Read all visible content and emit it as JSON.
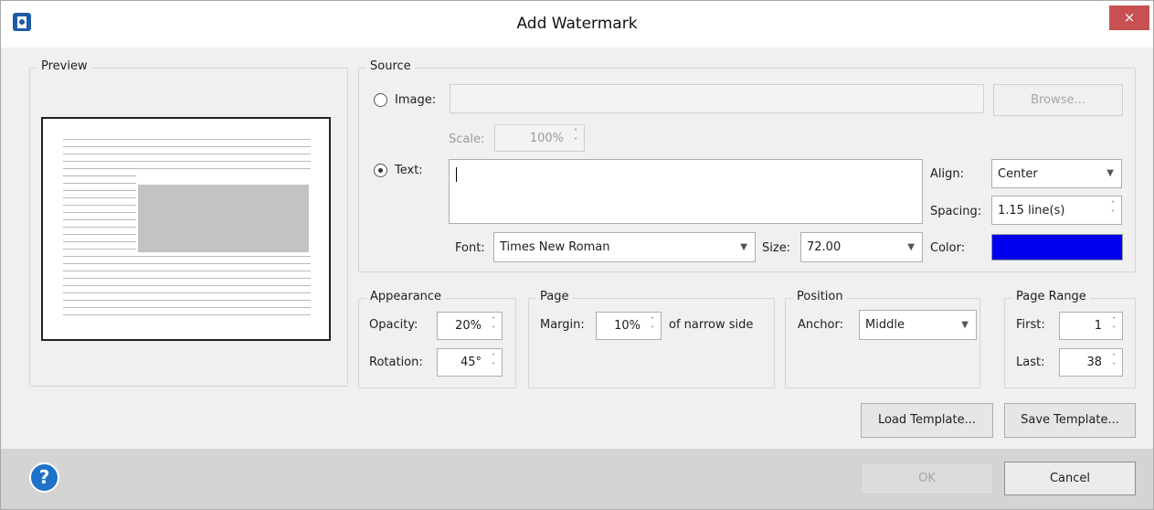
{
  "window": {
    "title": "Add Watermark",
    "close_glyph": "×"
  },
  "preview": {
    "legend": "Preview"
  },
  "source": {
    "legend": "Source",
    "image_label": "Image:",
    "image_path": "",
    "browse_label": "Browse...",
    "scale_label": "Scale:",
    "scale_value": "100%",
    "text_label": "Text:",
    "text_value": "",
    "align_label": "Align:",
    "align_value": "Center",
    "spacing_label": "Spacing:",
    "spacing_value": "1.15 line(s)",
    "font_label": "Font:",
    "font_value": "Times New Roman",
    "size_label": "Size:",
    "size_value": "72.00",
    "color_label": "Color:",
    "color_hex": "#0000ee"
  },
  "appearance": {
    "legend": "Appearance",
    "opacity_label": "Opacity:",
    "opacity_value": "20%",
    "rotation_label": "Rotation:",
    "rotation_value": "45°"
  },
  "page": {
    "legend": "Page",
    "margin_label": "Margin:",
    "margin_value": "10%",
    "margin_suffix": "of narrow side"
  },
  "position": {
    "legend": "Position",
    "anchor_label": "Anchor:",
    "anchor_value": "Middle"
  },
  "page_range": {
    "legend": "Page Range",
    "first_label": "First:",
    "first_value": "1",
    "last_label": "Last:",
    "last_value": "38"
  },
  "templates": {
    "load_label": "Load Template...",
    "save_label": "Save Template..."
  },
  "footer": {
    "help_glyph": "?",
    "ok_label": "OK",
    "cancel_label": "Cancel"
  },
  "colors": {
    "close_bg": "#c75050",
    "help_bg": "#1e73c8",
    "watermark_color": "#0000ee"
  }
}
